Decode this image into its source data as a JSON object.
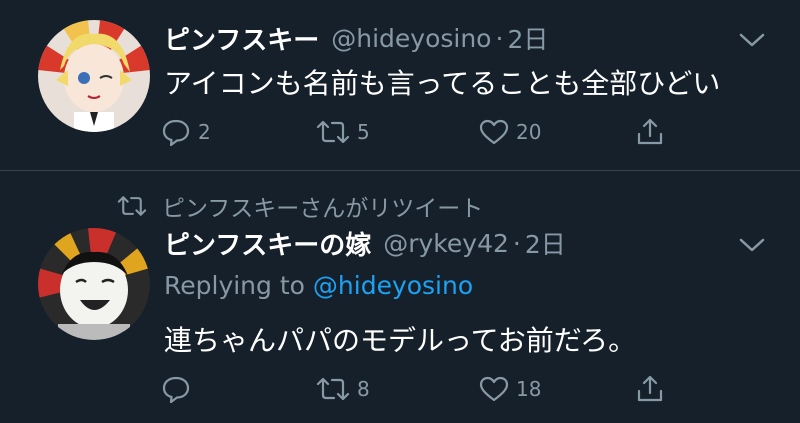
{
  "tweet1": {
    "name": "ピンフスキー",
    "handle": "@hideyosino",
    "dot": "·",
    "time": "2日",
    "text": "アイコンも名前も言ってることも全部ひどい",
    "reply_count": "2",
    "retweet_count": "5",
    "like_count": "20"
  },
  "tweet2": {
    "retweet_context": "ピンフスキーさんがリツイート",
    "name": "ピンフスキーの嫁",
    "handle": "@rykey42",
    "dot": "·",
    "time": "2日",
    "replying_prefix": "Replying to",
    "replying_mention": "@hideyosino",
    "text": "連ちゃんパパのモデルってお前だろ。",
    "reply_count": "",
    "retweet_count": "8",
    "like_count": "18"
  },
  "colors": {
    "background": "#15202b",
    "secondary_text": "#8899a6",
    "link": "#1da1f2",
    "divider": "#38444d"
  },
  "icons": [
    "reply-icon",
    "retweet-icon",
    "like-icon",
    "share-icon",
    "chevron-down-icon"
  ]
}
